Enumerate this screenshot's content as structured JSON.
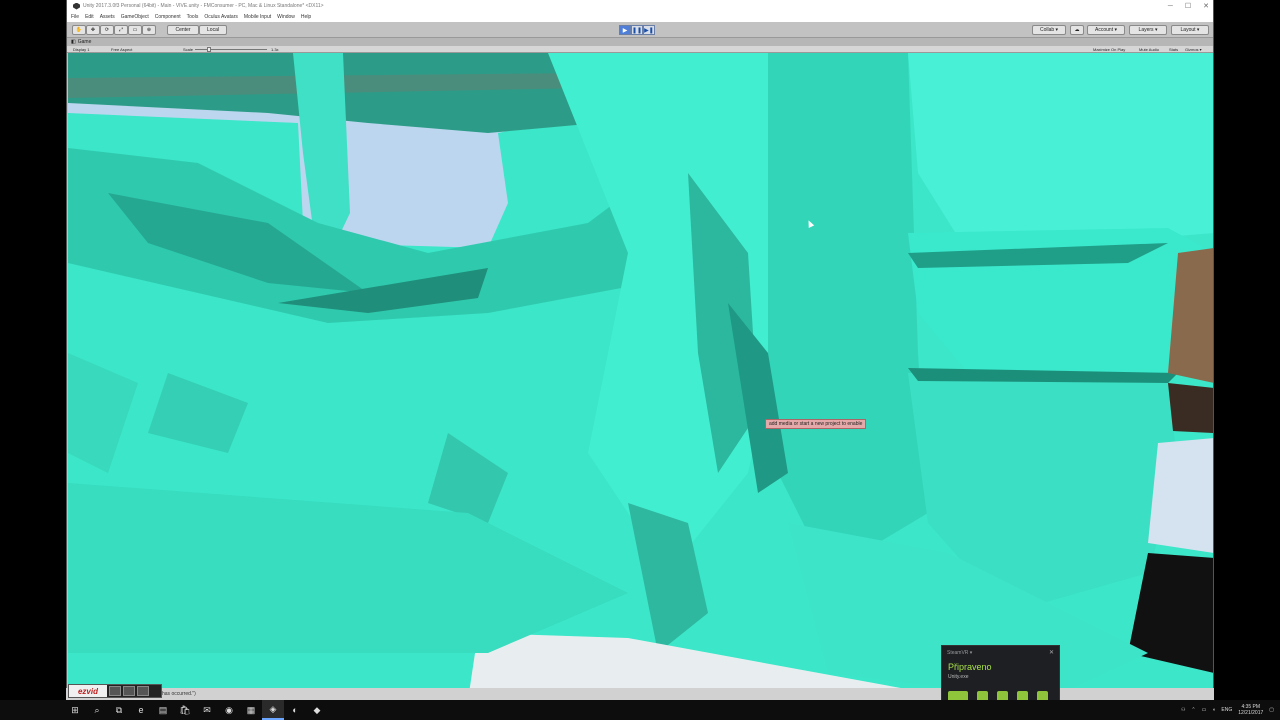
{
  "window": {
    "title": "Unity 2017.3.0f3 Personal (64bit) - Main - VIVE.unity - FMConsumer - PC, Mac & Linux Standalone* <DX11>",
    "controls": [
      "─",
      "☐",
      "✕"
    ]
  },
  "menu": [
    "File",
    "Edit",
    "Assets",
    "GameObject",
    "Component",
    "Tools",
    "Oculus Avatars",
    "Mobile Input",
    "Window",
    "Help"
  ],
  "toolbar": {
    "pivot": "Center",
    "space": "Local",
    "play": "▶",
    "pause": "❚❚",
    "step": "▶❚",
    "collab": "Collab ▾",
    "account": "Account ▾",
    "layers": "Layers ▾",
    "layout": "Layout ▾"
  },
  "game_tab": {
    "label": "Game",
    "display": "Display 1",
    "aspect": "Free Aspect",
    "scale_label": "Scale",
    "scale_value": "1.3x",
    "maximize": "Maximize On Play",
    "mute": "Mute Audio",
    "stats": "Stats",
    "gizmos": "Gizmos ▾"
  },
  "viewport": {
    "tooltip": "add media or start a new project to enable",
    "colors": {
      "mesh": "#3ce6c8",
      "sky": "#bcd6ef"
    }
  },
  "status": {
    "message": "has occurred.\")"
  },
  "ezvid": {
    "logo": "ezvid"
  },
  "steam": {
    "header": "SteamVR ▾",
    "title": "Připraveno",
    "subtitle": "Unity.exe"
  },
  "taskbar": {
    "items": [
      "⊞",
      "⌕",
      "⧉",
      "e",
      "▤",
      "🛍",
      "✉",
      "◉",
      "▦",
      "◈",
      "◐",
      "◆"
    ],
    "tray_lang": "ENG",
    "time": "4:35 PM",
    "date": "12/21/2017"
  }
}
